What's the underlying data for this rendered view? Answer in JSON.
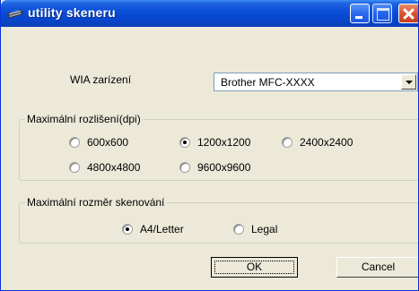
{
  "window": {
    "title": "utility skeneru",
    "icon": "scanner-icon"
  },
  "device": {
    "label": "WIA zarízení",
    "selected": "Brother  MFC-XXXX"
  },
  "resolution_group": {
    "title": "Maximální rozlišení(dpi)",
    "options": [
      "600x600",
      "1200x1200",
      "2400x2400",
      "4800x4800",
      "9600x9600"
    ],
    "selected": "1200x1200"
  },
  "size_group": {
    "title": "Maximální rozměr skenování",
    "options": [
      "A4/Letter",
      "Legal"
    ],
    "selected": "A4/Letter"
  },
  "buttons": {
    "ok": "OK",
    "cancel": "Cancel"
  }
}
